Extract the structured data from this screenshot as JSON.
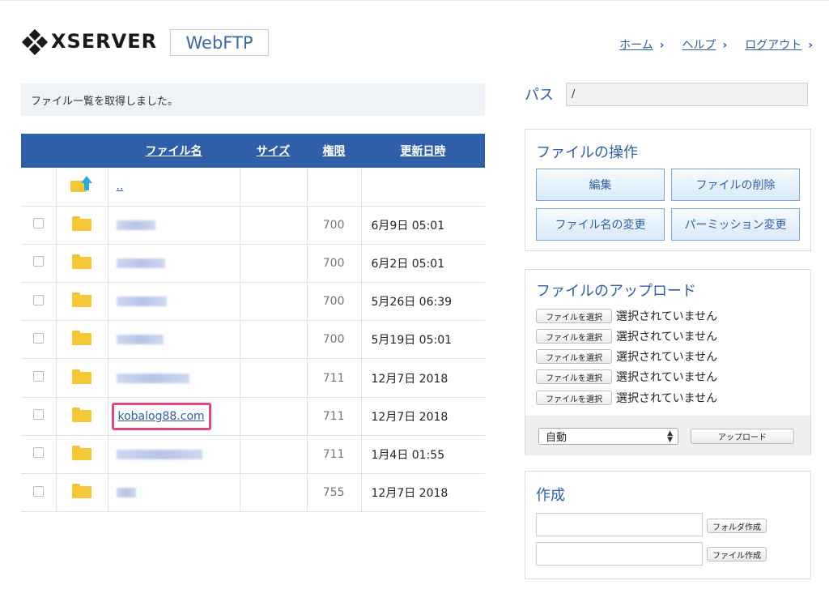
{
  "header": {
    "logo_text": "XSERVER",
    "app_name": "WebFTP",
    "nav": [
      {
        "label": "ホーム"
      },
      {
        "label": "ヘルプ"
      },
      {
        "label": "ログアウト"
      }
    ]
  },
  "status_message": "ファイル一覧を取得しました。",
  "table": {
    "headers": {
      "name": "ファイル名",
      "size": "サイズ",
      "perm": "権限",
      "date": "更新日時"
    },
    "parent_link": "..",
    "rows": [
      {
        "name": "",
        "perm": "700",
        "date": "6月9日 05:01"
      },
      {
        "name": "",
        "perm": "700",
        "date": "6月2日 05:01"
      },
      {
        "name": "",
        "perm": "700",
        "date": "5月26日 06:39"
      },
      {
        "name": "",
        "perm": "700",
        "date": "5月19日 05:01"
      },
      {
        "name": "",
        "perm": "711",
        "date": "12月7日 2018"
      },
      {
        "name": "kobalog88.com",
        "perm": "711",
        "date": "12月7日 2018"
      },
      {
        "name": "",
        "perm": "711",
        "date": "1月4日 01:55"
      },
      {
        "name": "",
        "perm": "755",
        "date": "12月7日 2018"
      }
    ]
  },
  "path": {
    "label": "パス",
    "value": "/"
  },
  "file_ops": {
    "title": "ファイルの操作",
    "buttons": [
      "編集",
      "ファイルの削除",
      "ファイル名の変更",
      "パーミッション変更"
    ]
  },
  "upload": {
    "title": "ファイルのアップロード",
    "choose_label": "ファイルを選択",
    "none_selected": "選択されていません",
    "mode_value": "自動",
    "upload_button": "アップロード"
  },
  "create": {
    "title": "作成",
    "folder_button": "フォルダ作成",
    "file_button": "ファイル作成"
  },
  "colors": {
    "accent": "#2f5fa8",
    "highlight": "#e0457b",
    "folder": "#f5c838"
  },
  "icons": [
    "xserver-logo-icon",
    "folder-icon",
    "parent-folder-icon",
    "chevron-right-icon",
    "select-arrows-icon"
  ]
}
